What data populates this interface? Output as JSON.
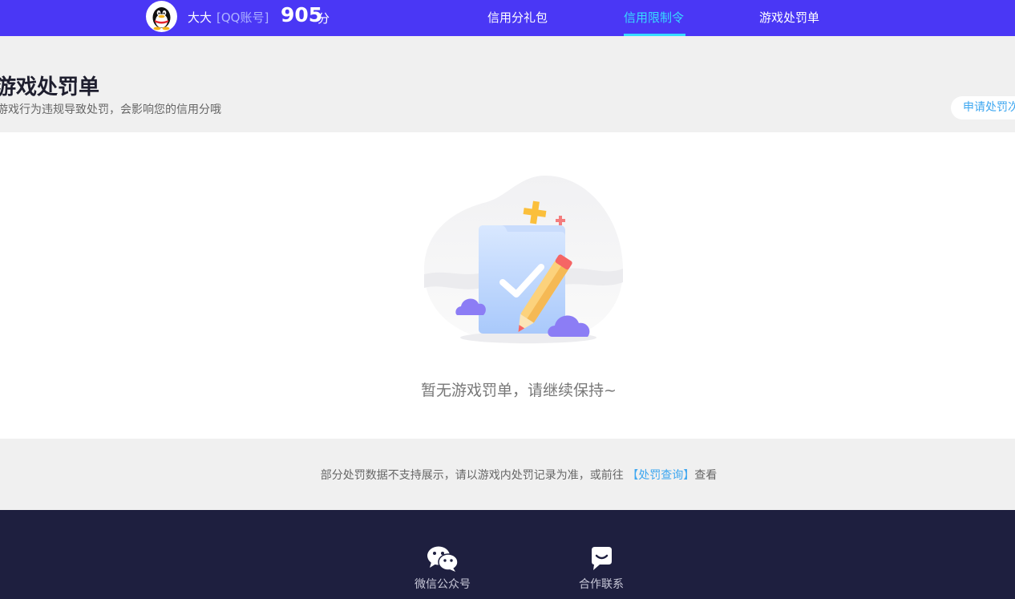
{
  "header": {
    "user_name": "大大",
    "account_type": "[QQ账号]",
    "score": "905",
    "score_unit": "分",
    "nav": [
      {
        "label": "信用分礼包",
        "active": false
      },
      {
        "label": "信用限制令",
        "active": true
      },
      {
        "label": "游戏处罚单",
        "active": false
      }
    ]
  },
  "page": {
    "title": "游戏处罚单",
    "subtitle": "游戏行为违规导致处罚，会影响您的信用分哦",
    "apply_button": "申请处罚次"
  },
  "empty_state": {
    "message": "暂无游戏罚单，请继续保持~"
  },
  "notice": {
    "text": "部分处罚数据不支持展示，请以游戏内处罚记录为准，或前往",
    "link": "【处罚查询】",
    "suffix": "查看"
  },
  "footer": {
    "items": [
      {
        "label": "微信公众号",
        "icon": "wechat-icon"
      },
      {
        "label": "合作联系",
        "icon": "chat-icon"
      }
    ]
  },
  "colors": {
    "header_bg": "#4a37f5",
    "accent": "#37dcff",
    "link": "#3ea7f0",
    "footer_bg": "#1e1f3f"
  }
}
